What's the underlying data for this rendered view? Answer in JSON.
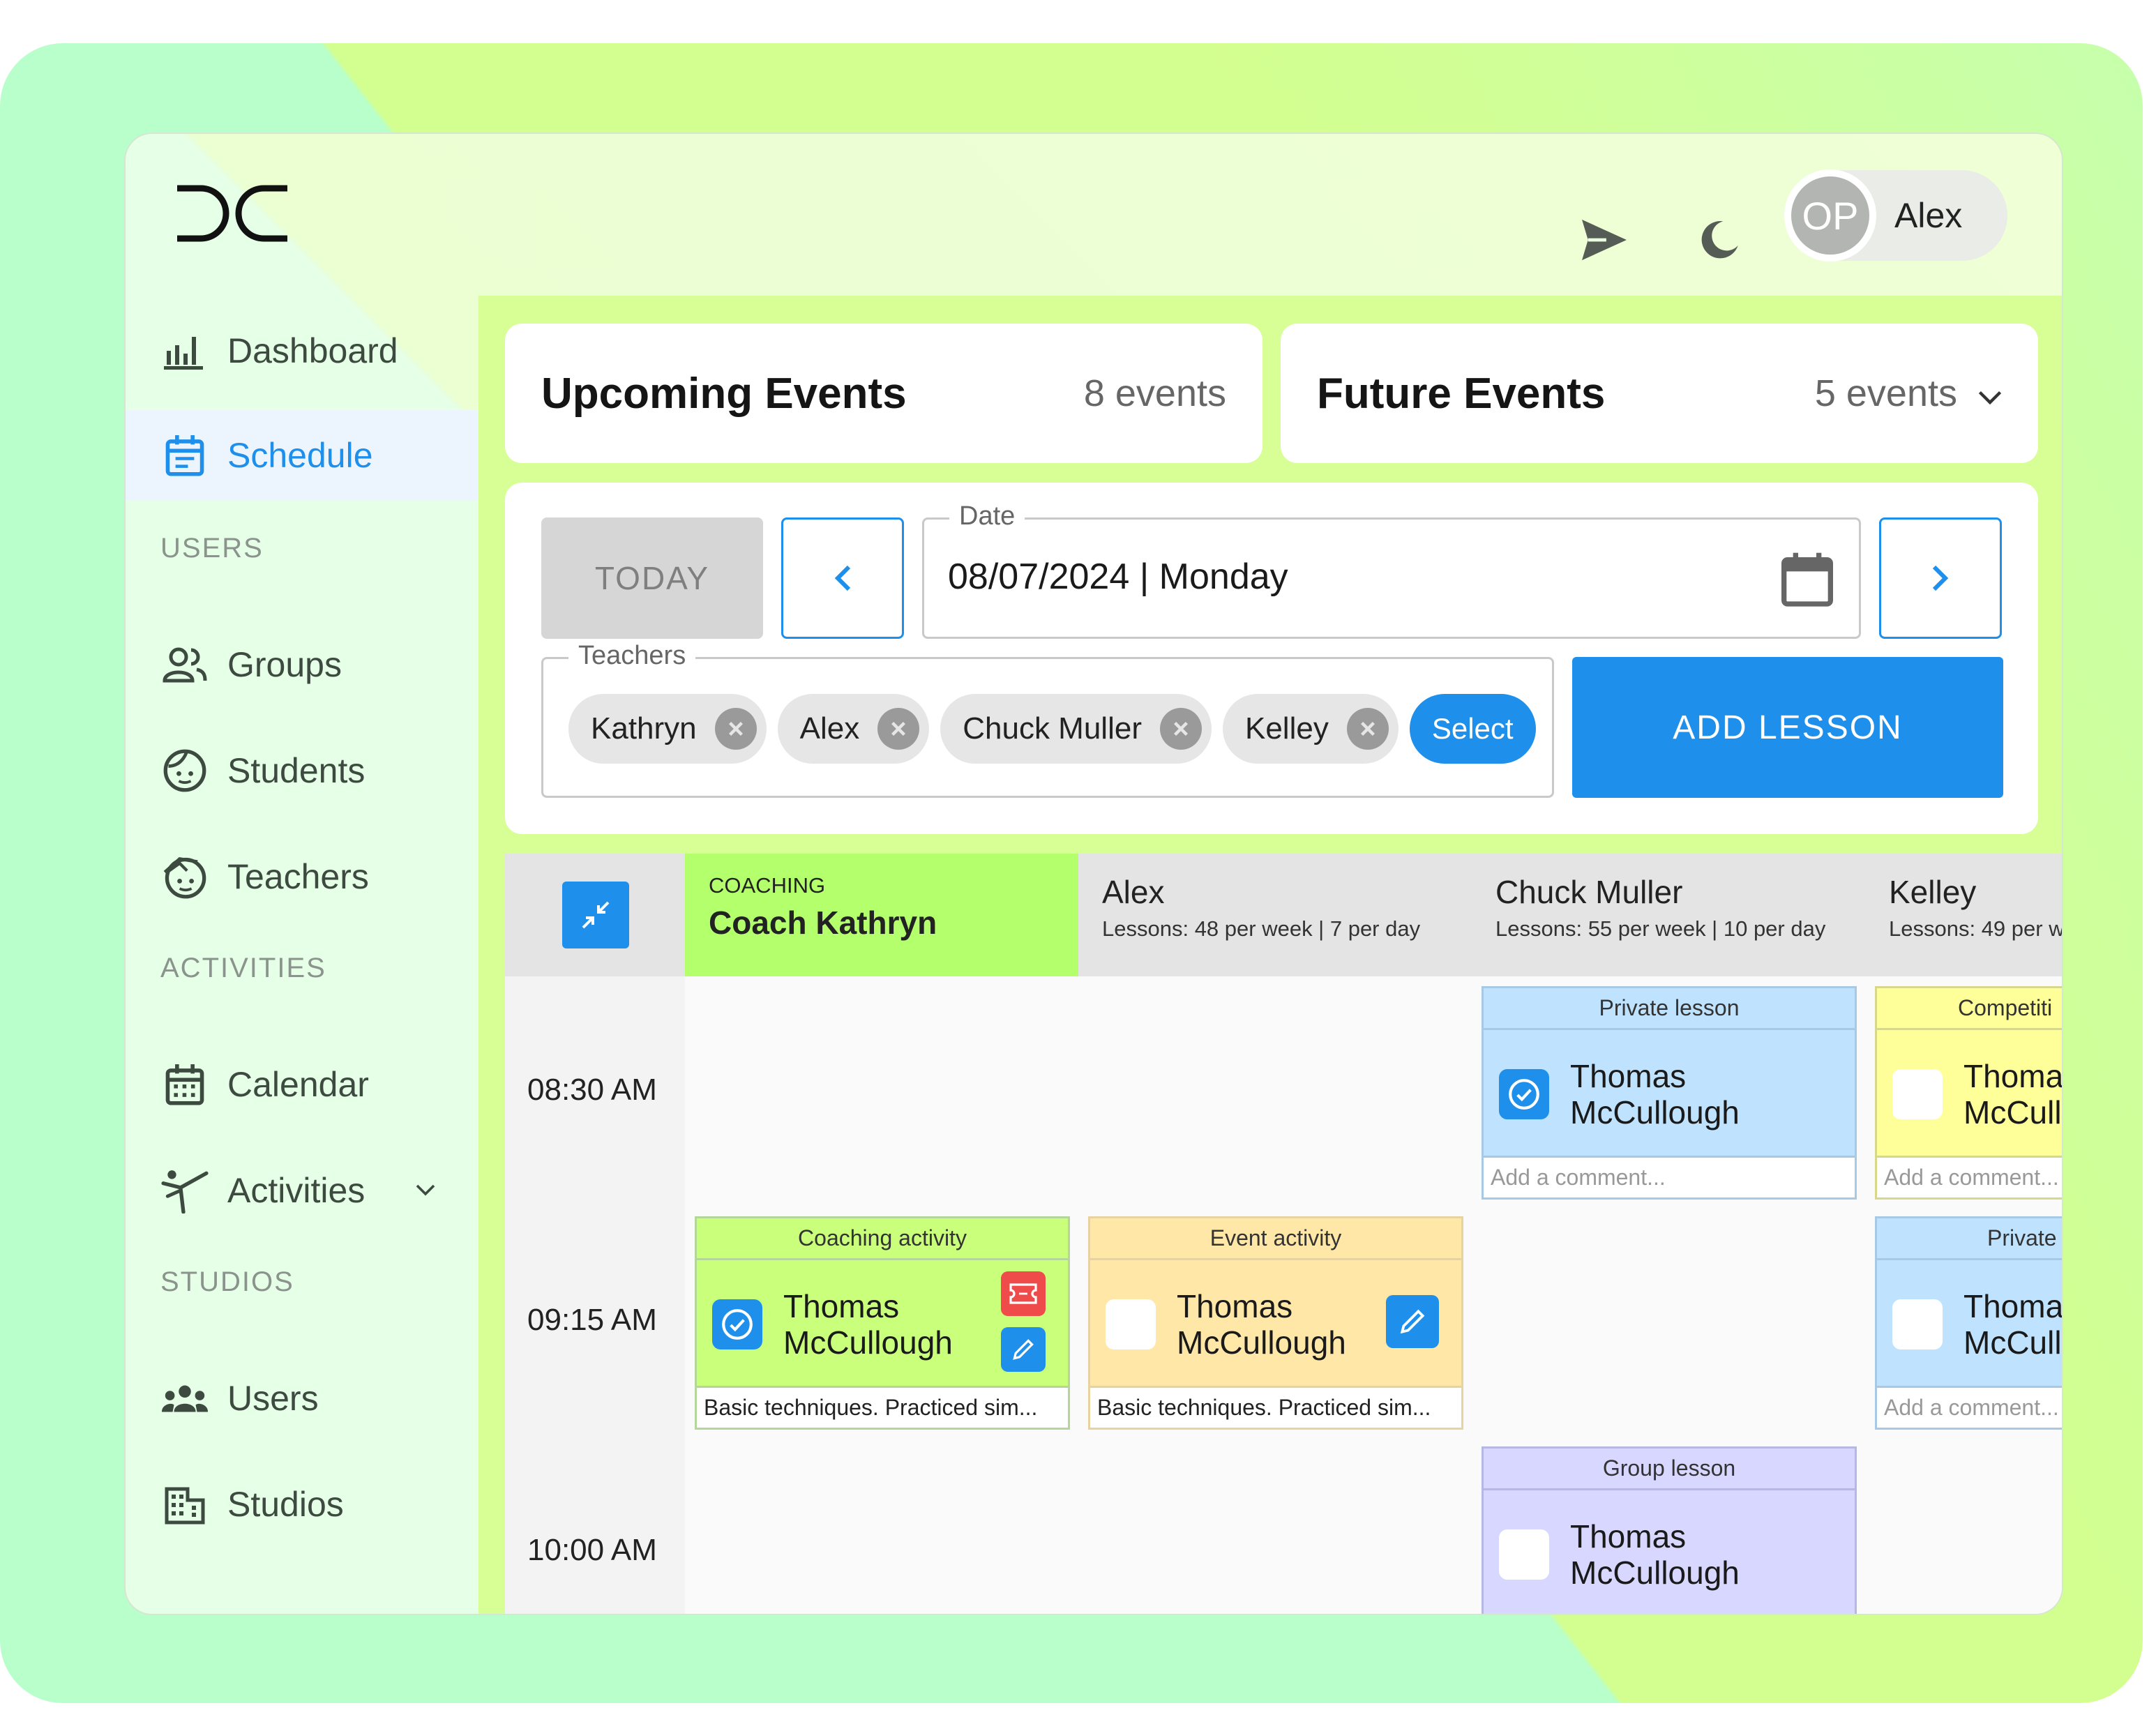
{
  "colors": {
    "accent": "#1e8fea",
    "coaching": "#b4ff6c",
    "event_activity": "#ffe7a8",
    "private_lesson": "#bfe3ff",
    "competition": "#ffff99",
    "group_lesson": "#d7d7ff"
  },
  "header": {
    "user_initials": "OP",
    "user_name": "Alex",
    "icons": [
      "send-icon",
      "moon-icon"
    ]
  },
  "sidebar": {
    "items": [
      {
        "label": "Dashboard",
        "icon": "bar-chart-icon"
      },
      {
        "label": "Schedule",
        "icon": "calendar-icon",
        "active": true
      }
    ],
    "sections": [
      {
        "title": "USERS",
        "items": [
          {
            "label": "Groups",
            "icon": "group-icon"
          },
          {
            "label": "Students",
            "icon": "student-face-icon"
          },
          {
            "label": "Teachers",
            "icon": "teacher-face-icon"
          }
        ]
      },
      {
        "title": "ACTIVITIES",
        "items": [
          {
            "label": "Calendar",
            "icon": "calendar-grid-icon"
          },
          {
            "label": "Activities",
            "icon": "activity-person-icon"
          }
        ]
      },
      {
        "title": "STUDIOS",
        "items": [
          {
            "label": "Users",
            "icon": "users-icon"
          },
          {
            "label": "Studios",
            "icon": "building-icon"
          }
        ]
      }
    ]
  },
  "summary": {
    "upcoming": {
      "title": "Upcoming Events",
      "count": "8 events"
    },
    "future": {
      "title": "Future Events",
      "count": "5 events"
    }
  },
  "controls": {
    "today_label": "TODAY",
    "date_legend": "Date",
    "date_value": "08/07/2024 | Monday",
    "teachers_legend": "Teachers",
    "teacher_chips": [
      "Kathryn",
      "Alex",
      "Chuck Muller",
      "Kelley"
    ],
    "select_label": "Select",
    "add_lesson_label": "ADD LESSON"
  },
  "schedule": {
    "columns": [
      {
        "small": "COACHING",
        "name": "Coach Kathryn"
      },
      {
        "name": "Alex",
        "sub": "Lessons: 48 per week | 7 per day"
      },
      {
        "name": "Chuck Muller",
        "sub": "Lessons: 55 per week | 10 per day"
      },
      {
        "name": "Kelley",
        "sub": "Lessons: 49 per w"
      }
    ],
    "times": [
      "08:30 AM",
      "09:15 AM",
      "10:00 AM"
    ],
    "events": [
      {
        "type": "Private lesson",
        "student_first": "Thomas",
        "student_last": "McCullough",
        "comment": "Add a comment...",
        "checked": true
      },
      {
        "type": "Competiti",
        "student_first": "Thomas",
        "student_last": "McCull",
        "comment": "Add a comment...",
        "checked": false
      },
      {
        "type": "Coaching activity",
        "student_first": "Thomas",
        "student_last": "McCullough",
        "comment": "Basic techniques. Practiced sim...",
        "checked": true
      },
      {
        "type": "Event activity",
        "student_first": "Thomas",
        "student_last": "McCullough",
        "comment": "Basic techniques. Practiced sim...",
        "checked": false
      },
      {
        "type": "Private",
        "student_first": "Thoma",
        "student_last": "McCull",
        "comment": "Add a comment...",
        "checked": false
      },
      {
        "type": "Group lesson",
        "student_first": "Thomas",
        "student_last": "McCullough",
        "checked": false
      }
    ]
  }
}
